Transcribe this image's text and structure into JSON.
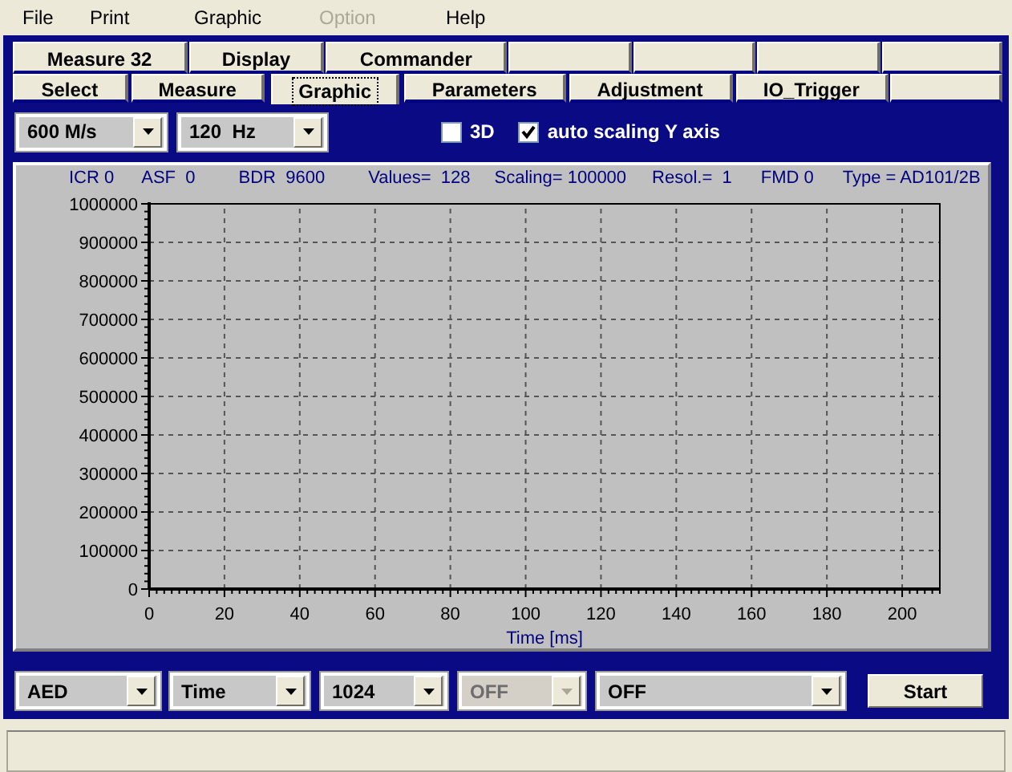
{
  "menu": [
    {
      "label": "File",
      "disabled": false
    },
    {
      "label": "Print",
      "disabled": false
    },
    {
      "label": "Graphic",
      "disabled": false
    },
    {
      "label": "Option",
      "disabled": true
    },
    {
      "label": "Help",
      "disabled": false
    }
  ],
  "tabs_row_1": [
    {
      "label": "Measure 32",
      "selected": false
    },
    {
      "label": "Display",
      "selected": false
    },
    {
      "label": "Commander",
      "selected": false
    },
    {
      "selected": false
    },
    {
      "selected": false
    },
    {
      "selected": false
    },
    {
      "selected": false
    }
  ],
  "tabs_row_2": [
    {
      "label": "Select",
      "selected": false
    },
    {
      "label": "Measure",
      "selected": false
    },
    {
      "label": "Graphic",
      "selected": true
    },
    {
      "label": "Parameters",
      "selected": false
    },
    {
      "label": "Adjustment",
      "selected": false
    },
    {
      "label": "IO_Trigger",
      "selected": false
    },
    {
      "selected": false
    }
  ],
  "toolbar": {
    "combos": [
      {
        "value": "600 M/s",
        "disabled": false
      },
      {
        "value": "120  Hz",
        "disabled": false
      }
    ],
    "checkboxes": [
      {
        "label": "3D",
        "checked": false
      },
      {
        "label": "auto scaling Y axis",
        "checked": true
      }
    ]
  },
  "chart": {
    "info": [
      "ICR 0",
      "ASF  0",
      "BDR  9600",
      "Values=  128",
      "Scaling= 100000",
      "Resol.=  1",
      "FMD 0",
      "Type = AD101/2B"
    ],
    "chart_data": {
      "type": "line",
      "grid": true,
      "xlabel": "Time [ms]",
      "xlim": [
        0,
        210
      ],
      "ylim": [
        0,
        1000000
      ],
      "xticks": [
        0,
        20,
        40,
        60,
        80,
        100,
        120,
        140,
        160,
        180,
        200
      ],
      "yticks": [
        0,
        100000,
        200000,
        300000,
        400000,
        500000,
        600000,
        700000,
        800000,
        900000,
        1000000
      ]
    }
  },
  "bottom": {
    "combos": [
      {
        "value": "AED",
        "disabled": false
      },
      {
        "value": "Time",
        "disabled": false
      },
      {
        "value": "1024",
        "disabled": false
      },
      {
        "value": "OFF",
        "disabled": true
      },
      {
        "value": "OFF",
        "disabled": false
      }
    ],
    "start_button": "Start"
  }
}
